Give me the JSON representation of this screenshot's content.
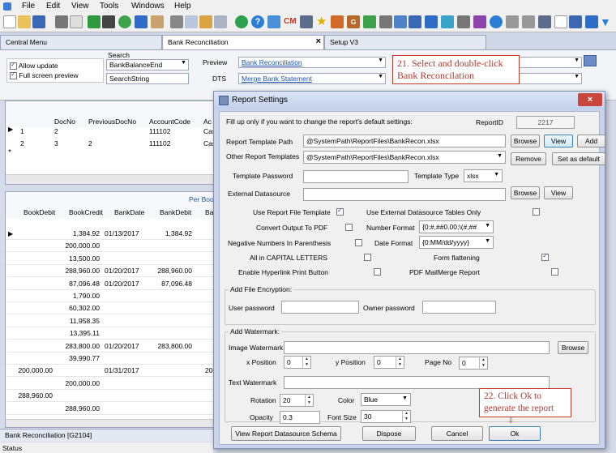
{
  "menu": [
    "File",
    "Edit",
    "View",
    "Tools",
    "Windows",
    "Help"
  ],
  "tabs": {
    "central": "Central Menu",
    "bank": "Bank Reconciliation",
    "setup": "Setup V3"
  },
  "topform": {
    "allow_update": "Allow update",
    "full_screen": "Full screen preview",
    "search_label": "Search",
    "search_value1": "BankBalanceEnd",
    "search_value2": "SearchString",
    "preview_label": "Preview",
    "preview_value": "Bank Reconciliation",
    "dts_label": "DTS",
    "dts_value": "Merge Bank Statement"
  },
  "callouts": {
    "step21": "21. Select and double-click Bank Reconcilation",
    "step22": "22. Click Ok to generate the report"
  },
  "upper_grid": {
    "headers": [
      "DocNo",
      "PreviousDocNo",
      "AccountCode",
      "Ac"
    ],
    "rows": [
      [
        "1",
        "2",
        "",
        "111102",
        "Cas"
      ],
      [
        "2",
        "3",
        "2",
        "111102",
        "Cas"
      ]
    ]
  },
  "lower_grid": {
    "group_header": "Per Boo",
    "headers": [
      "BookDebit",
      "BookCredit",
      "BankDate",
      "BankDebit",
      "Ba"
    ],
    "rows": [
      [
        "",
        "1,384.92",
        "01/13/2017",
        "1,384.92",
        ""
      ],
      [
        "",
        "200,000.00",
        "",
        "",
        ""
      ],
      [
        "",
        "13,500.00",
        "",
        "",
        ""
      ],
      [
        "",
        "288,960.00",
        "01/20/2017",
        "288,960.00",
        ""
      ],
      [
        "",
        "87,096.48",
        "01/20/2017",
        "87,096.48",
        ""
      ],
      [
        "",
        "1,790.00",
        "",
        "",
        ""
      ],
      [
        "",
        "60,302.00",
        "",
        "",
        ""
      ],
      [
        "",
        "11,958.35",
        "",
        "",
        ""
      ],
      [
        "",
        "13,395.11",
        "",
        "",
        ""
      ],
      [
        "",
        "283,800.00",
        "01/20/2017",
        "283,800.00",
        ""
      ],
      [
        "",
        "39,990.77",
        "",
        "",
        ""
      ],
      [
        "200,000.00",
        "",
        "01/31/2017",
        "",
        "200"
      ],
      [
        "",
        "200,000.00",
        "",
        "",
        ""
      ],
      [
        "288,960.00",
        "",
        "",
        "",
        ""
      ],
      [
        "",
        "288,960.00",
        "",
        "",
        ""
      ]
    ]
  },
  "bottom_tab": "Bank Reconciliation [G2104]",
  "status": "Status",
  "dialog": {
    "title": "Report Settings",
    "hint": "Fill up only if you want to change the report's default settings:",
    "report_id_label": "ReportID",
    "report_id": "2217",
    "template_path_label": "Report Template Path",
    "template_path": "@SystemPath\\ReportFiles\\BankRecon.xlsx",
    "other_templates_label": "Other Report Templates",
    "other_templates": "@SystemPath\\ReportFiles\\BankRecon.xlsx",
    "template_password_label": "Template Password",
    "template_password": "",
    "template_type_label": "Template Type",
    "template_type": "xlsx",
    "external_ds_label": "External Datasource",
    "external_ds": "",
    "btn_browse": "Browse",
    "btn_view": "View",
    "btn_add": "Add",
    "btn_remove": "Remove",
    "btn_set_default": "Set as default",
    "opt_use_template": "Use Report File Template",
    "opt_convert_pdf": "Convert Output To PDF",
    "opt_negative": "Negative Numbers In Parenthesis",
    "opt_capital": "All in CAPITAL LETTERS",
    "opt_hyperlink": "Enable Hyperlink Print Button",
    "opt_external_tables": "Use External Datasource Tables Only",
    "number_format_label": "Number Format",
    "number_format": "{0:#,##0.00;\\(#,##",
    "date_format_label": "Date Format",
    "date_format": "{0:MM/dd/yyyy}",
    "opt_form_flattening": "Form flattening",
    "opt_pdf_mailmerge": "PDF MailMerge Report",
    "encryption_group": "Add File Encryption:",
    "user_password_label": "User password",
    "owner_password_label": "Owner password",
    "watermark_group": "Add Watermark:",
    "image_watermark_label": "Image Watermark",
    "x_position_label": "x Position",
    "x_position": "0",
    "y_position_label": "y Position",
    "y_position": "0",
    "page_no_label": "Page No",
    "page_no": "0",
    "text_watermark_label": "Text Watermark",
    "rotation_label": "Rotation",
    "rotation": "20",
    "color_label": "Color",
    "color": "Blue",
    "opacity_label": "Opacity",
    "opacity": "0.3",
    "font_size_label": "Font Size",
    "font_size": "30",
    "btn_view_schema": "View Report Datasource Schema",
    "btn_dispose": "Dispose",
    "btn_cancel": "Cancel",
    "btn_ok": "Ok"
  },
  "colors": {
    "accent": "#1b55a8",
    "callout": "#c0392b",
    "dialog_frame": "#c9d4ea"
  }
}
